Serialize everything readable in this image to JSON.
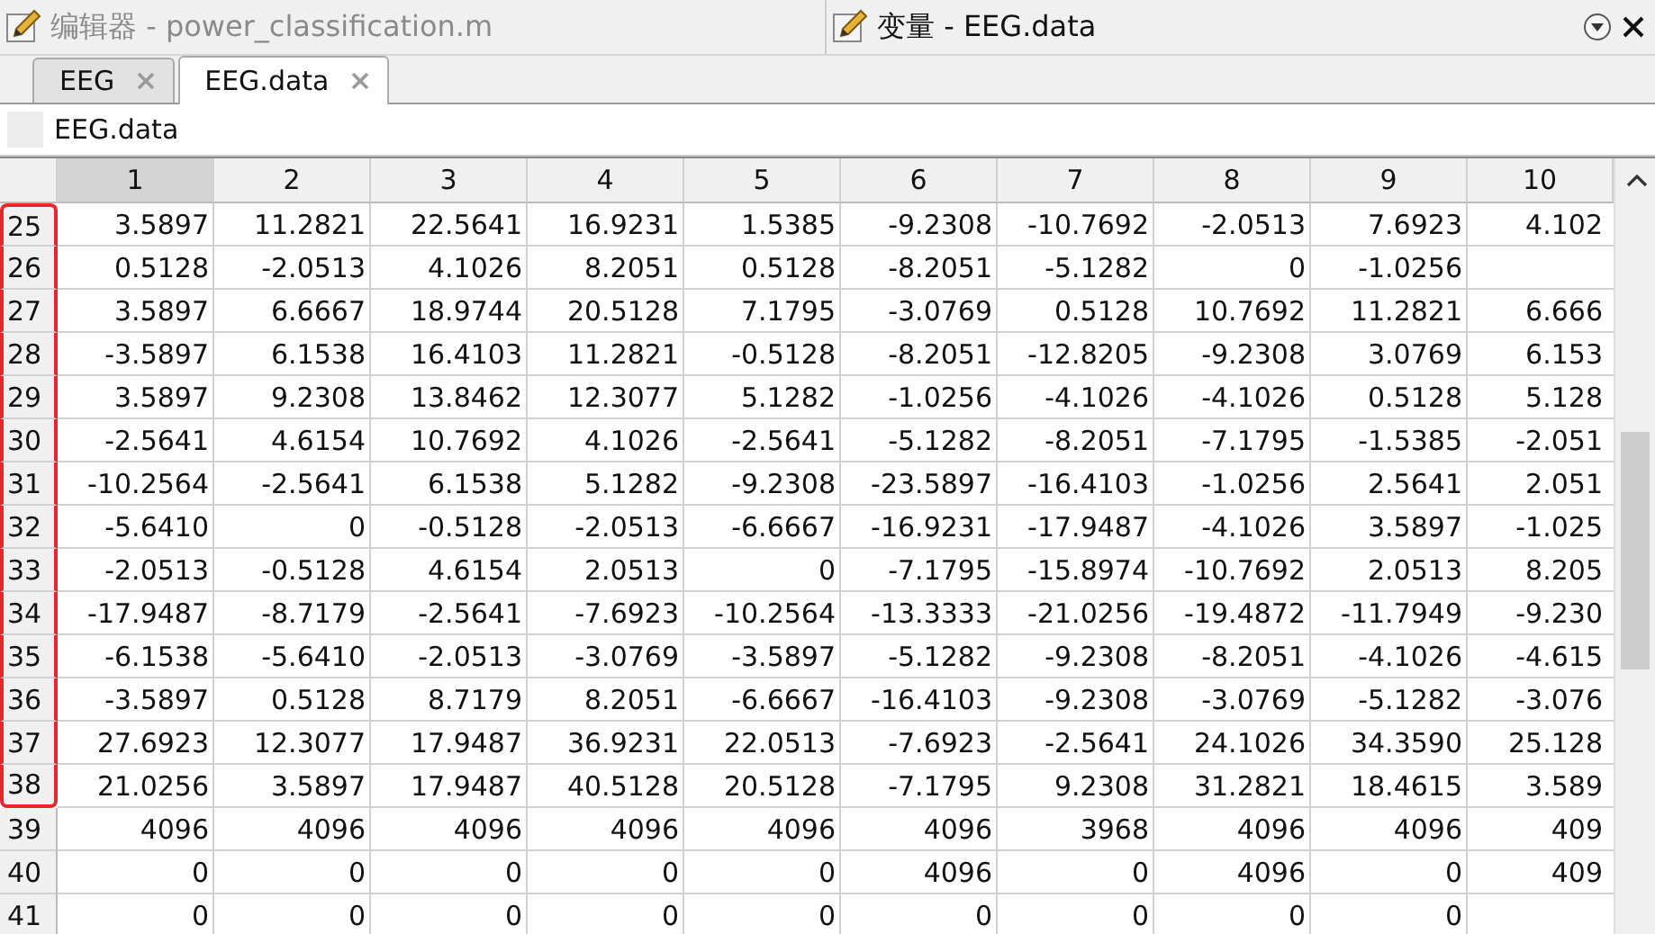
{
  "panes": [
    {
      "title": "编辑器 - power_classification.m",
      "selected": false
    },
    {
      "title": "变量 - EEG.data",
      "selected": true
    }
  ],
  "tabs": [
    {
      "label": "EEG",
      "selected": false
    },
    {
      "label": "EEG.data",
      "selected": true
    }
  ],
  "variable_name": "EEG.data",
  "table": {
    "columns": [
      {
        "label": "1",
        "selected": true
      },
      {
        "label": "2",
        "selected": false
      },
      {
        "label": "3",
        "selected": false
      },
      {
        "label": "4",
        "selected": false
      },
      {
        "label": "5",
        "selected": false
      },
      {
        "label": "6",
        "selected": false
      },
      {
        "label": "7",
        "selected": false
      },
      {
        "label": "8",
        "selected": false
      },
      {
        "label": "9",
        "selected": false
      },
      {
        "label": "10",
        "selected": false
      }
    ],
    "rows": [
      {
        "index": "25",
        "highlighted": true,
        "cells": [
          "3.5897",
          "11.2821",
          "22.5641",
          "16.9231",
          "1.5385",
          "-9.2308",
          "-10.7692",
          "-2.0513",
          "7.6923",
          "4.102"
        ]
      },
      {
        "index": "26",
        "highlighted": true,
        "cells": [
          "0.5128",
          "-2.0513",
          "4.1026",
          "8.2051",
          "0.5128",
          "-8.2051",
          "-5.1282",
          "0",
          "-1.0256"
        ]
      },
      {
        "index": "27",
        "highlighted": true,
        "cells": [
          "3.5897",
          "6.6667",
          "18.9744",
          "20.5128",
          "7.1795",
          "-3.0769",
          "0.5128",
          "10.7692",
          "11.2821",
          "6.666"
        ]
      },
      {
        "index": "28",
        "highlighted": true,
        "cells": [
          "-3.5897",
          "6.1538",
          "16.4103",
          "11.2821",
          "-0.5128",
          "-8.2051",
          "-12.8205",
          "-9.2308",
          "3.0769",
          "6.153"
        ]
      },
      {
        "index": "29",
        "highlighted": true,
        "cells": [
          "3.5897",
          "9.2308",
          "13.8462",
          "12.3077",
          "5.1282",
          "-1.0256",
          "-4.1026",
          "-4.1026",
          "0.5128",
          "5.128"
        ]
      },
      {
        "index": "30",
        "highlighted": true,
        "cells": [
          "-2.5641",
          "4.6154",
          "10.7692",
          "4.1026",
          "-2.5641",
          "-5.1282",
          "-8.2051",
          "-7.1795",
          "-1.5385",
          "-2.051"
        ]
      },
      {
        "index": "31",
        "highlighted": true,
        "cells": [
          "-10.2564",
          "-2.5641",
          "6.1538",
          "5.1282",
          "-9.2308",
          "-23.5897",
          "-16.4103",
          "-1.0256",
          "2.5641",
          "2.051"
        ]
      },
      {
        "index": "32",
        "highlighted": true,
        "cells": [
          "-5.6410",
          "0",
          "-0.5128",
          "-2.0513",
          "-6.6667",
          "-16.9231",
          "-17.9487",
          "-4.1026",
          "3.5897",
          "-1.025"
        ]
      },
      {
        "index": "33",
        "highlighted": true,
        "cells": [
          "-2.0513",
          "-0.5128",
          "4.6154",
          "2.0513",
          "0",
          "-7.1795",
          "-15.8974",
          "-10.7692",
          "2.0513",
          "8.205"
        ]
      },
      {
        "index": "34",
        "highlighted": true,
        "cells": [
          "-17.9487",
          "-8.7179",
          "-2.5641",
          "-7.6923",
          "-10.2564",
          "-13.3333",
          "-21.0256",
          "-19.4872",
          "-11.7949",
          "-9.230"
        ]
      },
      {
        "index": "35",
        "highlighted": true,
        "cells": [
          "-6.1538",
          "-5.6410",
          "-2.0513",
          "-3.0769",
          "-3.5897",
          "-5.1282",
          "-9.2308",
          "-8.2051",
          "-4.1026",
          "-4.615"
        ]
      },
      {
        "index": "36",
        "highlighted": true,
        "cells": [
          "-3.5897",
          "0.5128",
          "8.7179",
          "8.2051",
          "-6.6667",
          "-16.4103",
          "-9.2308",
          "-3.0769",
          "-5.1282",
          "-3.076"
        ]
      },
      {
        "index": "37",
        "highlighted": true,
        "cells": [
          "27.6923",
          "12.3077",
          "17.9487",
          "36.9231",
          "22.0513",
          "-7.6923",
          "-2.5641",
          "24.1026",
          "34.3590",
          "25.128"
        ]
      },
      {
        "index": "38",
        "highlighted": true,
        "cells": [
          "21.0256",
          "3.5897",
          "17.9487",
          "40.5128",
          "20.5128",
          "-7.1795",
          "9.2308",
          "31.2821",
          "18.4615",
          "3.589"
        ]
      },
      {
        "index": "39",
        "highlighted": false,
        "cells": [
          "4096",
          "4096",
          "4096",
          "4096",
          "4096",
          "4096",
          "3968",
          "4096",
          "4096",
          "409"
        ]
      },
      {
        "index": "40",
        "highlighted": false,
        "cells": [
          "0",
          "0",
          "0",
          "0",
          "0",
          "4096",
          "0",
          "4096",
          "0",
          "409"
        ]
      },
      {
        "index": "41",
        "highlighted": false,
        "cells": [
          "0",
          "0",
          "0",
          "0",
          "0",
          "0",
          "0",
          "0",
          "0"
        ]
      }
    ]
  }
}
